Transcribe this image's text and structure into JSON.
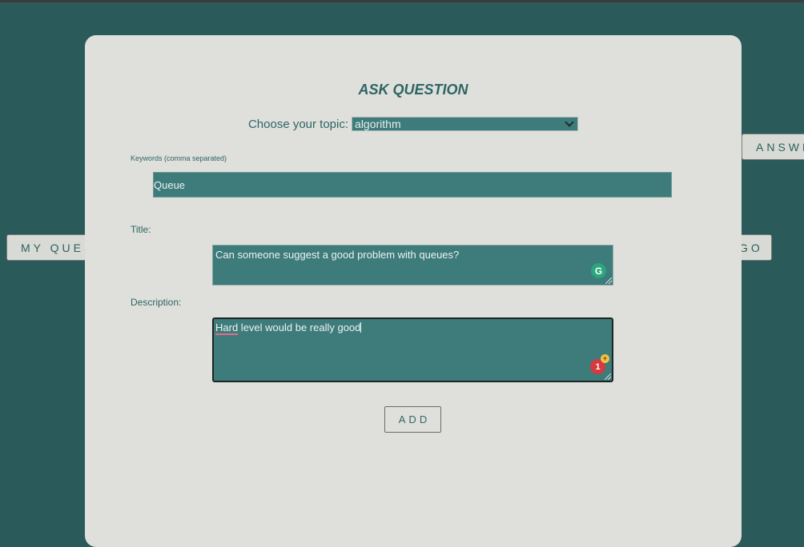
{
  "background_buttons": {
    "answer": "ANSWE",
    "my_questions": "MY QUES",
    "go": "GO"
  },
  "modal": {
    "title": "ASK QUESTION",
    "topic_label": "Choose your topic:",
    "topic_selected": "algorithm",
    "keywords_label": "Keywords (comma separated)",
    "keywords_value": "Queue",
    "title_label": "Title:",
    "title_value": "Can someone suggest a good problem with queues?",
    "description_label": "Description:",
    "description_misspelled": "Hard",
    "description_rest": " level would be really good",
    "add_label": "ADD"
  },
  "grammarly": {
    "title_icon": "G",
    "desc_badge": "1",
    "desc_plus": "+"
  },
  "colors": {
    "page_background": "#2b5a5a",
    "modal_background": "#dfe0db",
    "field_background": "#3e7b7b",
    "accent_text": "#2e6565"
  }
}
